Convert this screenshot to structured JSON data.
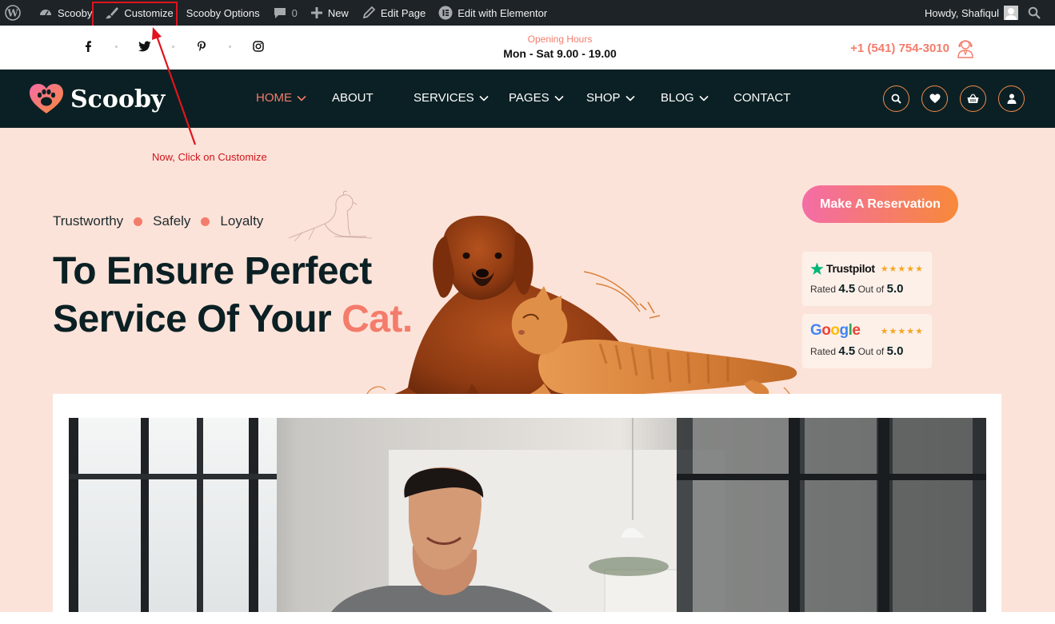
{
  "admin_bar": {
    "site_name": "Scooby",
    "customize": "Customize",
    "options": "Scooby Options",
    "comments_count": "0",
    "new": "New",
    "edit_page": "Edit Page",
    "elementor": "Edit with Elementor",
    "howdy": "Howdy, Shafiqul"
  },
  "annotation": {
    "text": "Now, Click on Customize",
    "color": "#d0141b"
  },
  "topbar": {
    "socials": [
      "facebook-icon",
      "twitter-icon",
      "pinterest-icon",
      "instagram-icon"
    ],
    "hours_label": "Opening Hours",
    "hours_value": "Mon - Sat 9.00 - 19.00",
    "phone": "+1 (541) 754-3010"
  },
  "nav": {
    "logo": "Scooby",
    "items": [
      {
        "label": "HOME",
        "dropdown": true,
        "active": true
      },
      {
        "label": "ABOUT",
        "dropdown": false
      },
      {
        "label": "SERVICES",
        "dropdown": true
      },
      {
        "label": "PAGES",
        "dropdown": true
      },
      {
        "label": "SHOP",
        "dropdown": true
      },
      {
        "label": "BLOG",
        "dropdown": true
      },
      {
        "label": "CONTACT",
        "dropdown": false
      }
    ],
    "icons": [
      "search-icon",
      "heart-icon",
      "basket-icon",
      "user-icon"
    ]
  },
  "hero": {
    "tags": [
      "Trustworthy",
      "Safely",
      "Loyalty"
    ],
    "headline_line1": "To Ensure Perfect",
    "headline_line2": "Service Of Your",
    "headline_accent": "Cat.",
    "cta": "Make A Reservation",
    "ratings": [
      {
        "brand": "Trustpilot",
        "stars": "★★★★★",
        "rated": "Rated",
        "score": "4.5",
        "out_of": "Out of",
        "max": "5.0"
      },
      {
        "brand": "Google",
        "stars": "★★★★★",
        "rated": "Rated",
        "score": "4.5",
        "out_of": "Out of",
        "max": "5.0"
      }
    ]
  },
  "colors": {
    "admin_bar": "#1d2327",
    "nav_bg": "#0b2024",
    "accent": "#f47c6b",
    "hero_bg": "#fce3d9"
  }
}
